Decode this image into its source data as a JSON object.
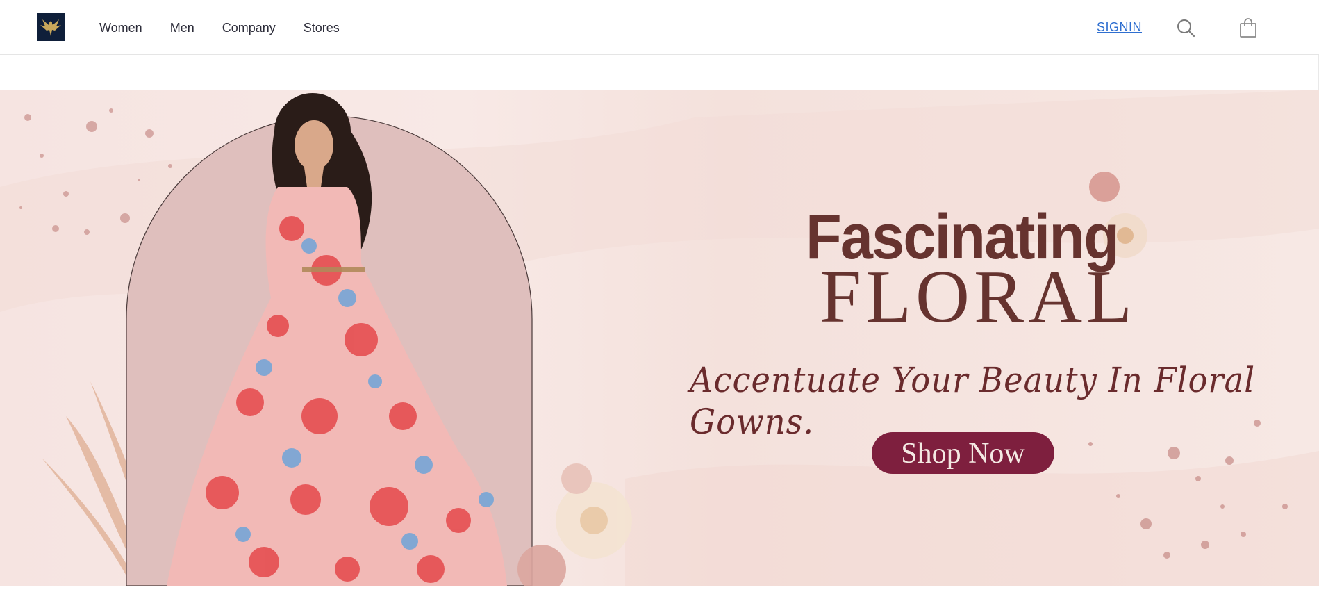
{
  "header": {
    "logo_alt": "eagle-emblem",
    "nav": [
      {
        "label": "Women"
      },
      {
        "label": "Men"
      },
      {
        "label": "Company"
      },
      {
        "label": "Stores"
      }
    ],
    "signin_label": "SIGNIN",
    "icons": {
      "search": "search-icon",
      "cart": "shopping-bag-icon"
    }
  },
  "hero": {
    "headline_line1": "Fascinating",
    "headline_line2": "FLORAL",
    "tagline": "Accentuate Your Beauty In Floral Gowns.",
    "cta_label": "Shop Now"
  },
  "colors": {
    "accent_text": "#66332f",
    "cta_background": "#7e1f3e",
    "signin": "#2f6fd0",
    "hero_background": "#f6e4e1",
    "arch": "#dfbfbd"
  }
}
